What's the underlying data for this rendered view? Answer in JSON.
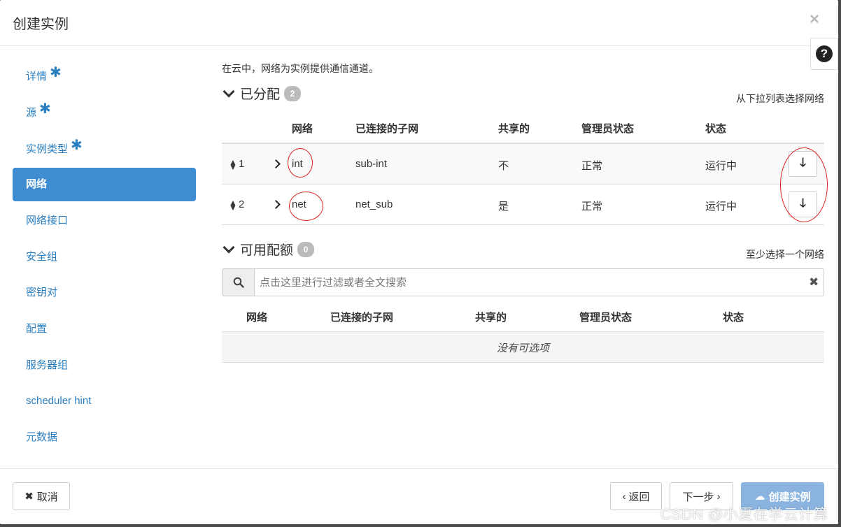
{
  "modal": {
    "title": "创建实例",
    "close_icon": "×",
    "help_icon": "?"
  },
  "sidebar": {
    "items": [
      {
        "label": "详情",
        "required": true
      },
      {
        "label": "源",
        "required": true
      },
      {
        "label": "实例类型",
        "required": true
      },
      {
        "label": "网络",
        "required": false,
        "active": true
      },
      {
        "label": "网络接口",
        "required": false
      },
      {
        "label": "安全组",
        "required": false
      },
      {
        "label": "密钥对",
        "required": false
      },
      {
        "label": "配置",
        "required": false
      },
      {
        "label": "服务器组",
        "required": false
      },
      {
        "label": "scheduler hint",
        "required": false
      },
      {
        "label": "元数据",
        "required": false
      }
    ],
    "required_mark": "✱"
  },
  "intro": "在云中，网络为实例提供通信通道。",
  "allocated": {
    "title": "已分配",
    "count": "2",
    "hint": "从下拉列表选择网络",
    "headers": [
      "网络",
      "已连接的子网",
      "共享的",
      "管理员状态",
      "状态"
    ],
    "rows": [
      {
        "index": "1",
        "network": "int",
        "subnet": "sub-int",
        "shared": "不",
        "admin_state": "正常",
        "status": "运行中"
      },
      {
        "index": "2",
        "network": "net",
        "subnet": "net_sub",
        "shared": "是",
        "admin_state": "正常",
        "status": "运行中"
      }
    ]
  },
  "available": {
    "title": "可用配额",
    "count": "0",
    "hint": "至少选择一个网络",
    "search_placeholder": "点击这里进行过滤或者全文搜索",
    "headers": [
      "网络",
      "已连接的子网",
      "共享的",
      "管理员状态",
      "状态"
    ],
    "empty_text": "没有可选项"
  },
  "footer": {
    "cancel": "取消",
    "back": "返回",
    "next": "下一步",
    "create": "创建实例"
  },
  "watermark": "CSDN @小夏在学云计算",
  "colors": {
    "accent": "#3f8cd0",
    "link": "#2a7fc0",
    "primary_disabled": "#8ab4df",
    "annotation": "#dd2222"
  }
}
